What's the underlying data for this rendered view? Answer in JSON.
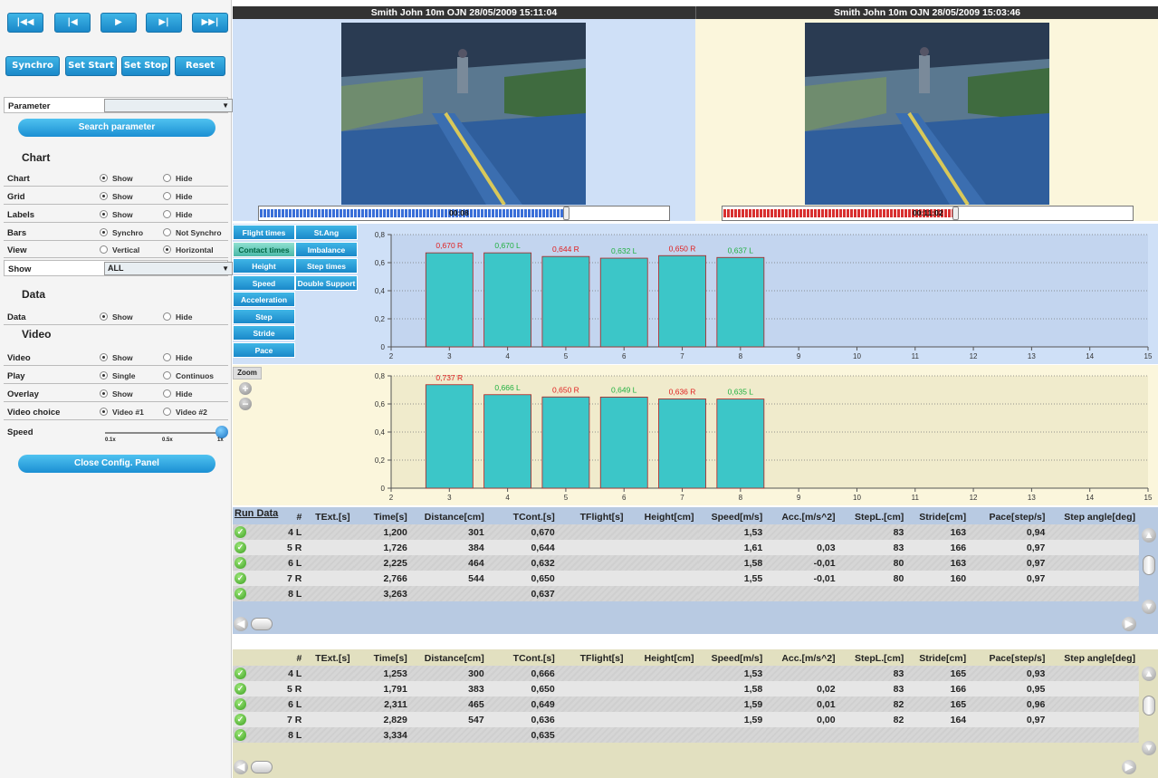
{
  "transport": [
    "|◀◀",
    "|◀",
    "▶",
    "▶|",
    "▶▶|"
  ],
  "sync_buttons": [
    "Synchro",
    "Set Start",
    "Set Stop",
    "Reset"
  ],
  "parameter": {
    "label": "Parameter",
    "value": "",
    "search": "Search parameter"
  },
  "sections": {
    "chart": "Chart",
    "data": "Data",
    "video": "Video"
  },
  "chart_rows": [
    {
      "label": "Chart",
      "o1": "Show",
      "o2": "Hide",
      "sel": 1
    },
    {
      "label": "Grid",
      "o1": "Show",
      "o2": "Hide",
      "sel": 1
    },
    {
      "label": "Labels",
      "o1": "Show",
      "o2": "Hide",
      "sel": 1
    },
    {
      "label": "Bars",
      "o1": "Synchro",
      "o2": "Not Synchro",
      "sel": 1
    },
    {
      "label": "View",
      "o1": "Vertical",
      "o2": "Horizontal",
      "sel": 2
    }
  ],
  "show_row": {
    "label": "Show",
    "value": "ALL"
  },
  "data_row": {
    "label": "Data",
    "o1": "Show",
    "o2": "Hide",
    "sel": 1
  },
  "video_rows": [
    {
      "label": "Video",
      "o1": "Show",
      "o2": "Hide",
      "sel": 1
    },
    {
      "label": "Play",
      "o1": "Single",
      "o2": "Continuos",
      "sel": 1
    },
    {
      "label": "Overlay",
      "o1": "Show",
      "o2": "Hide",
      "sel": 1
    },
    {
      "label": "Video choice",
      "o1": "Video #1",
      "o2": "Video #2",
      "sel": 1
    }
  ],
  "speed": {
    "label": "Speed",
    "ticks": [
      "0.1x",
      "0.5x",
      "1x"
    ],
    "level": 1.0
  },
  "close_panel": "Close Config. Panel",
  "video1": {
    "title": "Smith John 10m OJN 28/05/2009 15:11:04",
    "time": "00:08",
    "progress": 0.75,
    "color": "#3a6fd8"
  },
  "video2": {
    "title": "Smith John 10m OJN 28/05/2009 15:03:46",
    "time": "00:11:02",
    "progress": 0.57,
    "color": "#d83030"
  },
  "metric_buttons": {
    "left": [
      "Flight times",
      "Contact times",
      "Height",
      "Speed",
      "Acceleration",
      "Step",
      "Stride",
      "Pace"
    ],
    "right": [
      "St.Ang",
      "Imbalance",
      "Step times",
      "Double Support"
    ]
  },
  "zoom": {
    "label": "Zoom"
  },
  "chart_data": [
    {
      "type": "bar",
      "x": [
        3,
        4,
        5,
        6,
        7,
        8
      ],
      "values": [
        0.67,
        0.67,
        0.644,
        0.632,
        0.65,
        0.637
      ],
      "labels": [
        "0,670 R",
        "0,670 L",
        "0,644 R",
        "0,632 L",
        "0,650 R",
        "0,637 L"
      ],
      "xlim": [
        2,
        15
      ],
      "ylim": [
        0,
        0.8
      ],
      "xticks": [
        "2",
        "3",
        "4",
        "5",
        "6",
        "7",
        "8",
        "9",
        "10",
        "11",
        "12",
        "13",
        "14",
        "15"
      ],
      "yticks": [
        "0",
        "0,2",
        "0,4",
        "0,6",
        "0,8"
      ]
    },
    {
      "type": "bar",
      "x": [
        3,
        4,
        5,
        6,
        7,
        8
      ],
      "values": [
        0.737,
        0.666,
        0.65,
        0.649,
        0.636,
        0.635
      ],
      "labels": [
        "0,737 R",
        "0,666 L",
        "0,650 R",
        "0,649 L",
        "0,636 R",
        "0,635 L"
      ],
      "xlim": [
        2,
        15
      ],
      "ylim": [
        0,
        0.8
      ],
      "xticks": [
        "2",
        "3",
        "4",
        "5",
        "6",
        "7",
        "8",
        "9",
        "10",
        "11",
        "12",
        "13",
        "14",
        "15"
      ],
      "yticks": [
        "0",
        "0,2",
        "0,4",
        "0,6",
        "0,8"
      ]
    }
  ],
  "run_data_title": "Run Data",
  "columns": [
    "#",
    "TExt.[s]",
    "Time[s]",
    "Distance[cm]",
    "TCont.[s]",
    "TFlight[s]",
    "Height[cm]",
    "Speed[m/s]",
    "Acc.[m/s^2]",
    "StepL.[cm]",
    "Stride[cm]",
    "Pace[step/s]",
    "Step angle[deg]"
  ],
  "table1": [
    [
      "4 L",
      "",
      "1,200",
      "301",
      "0,670",
      "",
      "",
      "1,53",
      "",
      "83",
      "163",
      "0,94",
      ""
    ],
    [
      "5 R",
      "",
      "1,726",
      "384",
      "0,644",
      "",
      "",
      "1,61",
      "0,03",
      "83",
      "166",
      "0,97",
      ""
    ],
    [
      "6 L",
      "",
      "2,225",
      "464",
      "0,632",
      "",
      "",
      "1,58",
      "-0,01",
      "80",
      "163",
      "0,97",
      ""
    ],
    [
      "7 R",
      "",
      "2,766",
      "544",
      "0,650",
      "",
      "",
      "1,55",
      "-0,01",
      "80",
      "160",
      "0,97",
      ""
    ],
    [
      "8 L",
      "",
      "3,263",
      "",
      "0,637",
      "",
      "",
      "",
      "",
      "",
      "",
      "",
      ""
    ]
  ],
  "table2": [
    [
      "4 L",
      "",
      "1,253",
      "300",
      "0,666",
      "",
      "",
      "1,53",
      "",
      "83",
      "165",
      "0,93",
      ""
    ],
    [
      "5 R",
      "",
      "1,791",
      "383",
      "0,650",
      "",
      "",
      "1,58",
      "0,02",
      "83",
      "166",
      "0,95",
      ""
    ],
    [
      "6 L",
      "",
      "2,311",
      "465",
      "0,649",
      "",
      "",
      "1,59",
      "0,01",
      "82",
      "165",
      "0,96",
      ""
    ],
    [
      "7 R",
      "",
      "2,829",
      "547",
      "0,636",
      "",
      "",
      "1,59",
      "0,00",
      "82",
      "164",
      "0,97",
      ""
    ],
    [
      "8 L",
      "",
      "3,334",
      "",
      "0,635",
      "",
      "",
      "",
      "",
      "",
      "",
      "",
      ""
    ]
  ]
}
